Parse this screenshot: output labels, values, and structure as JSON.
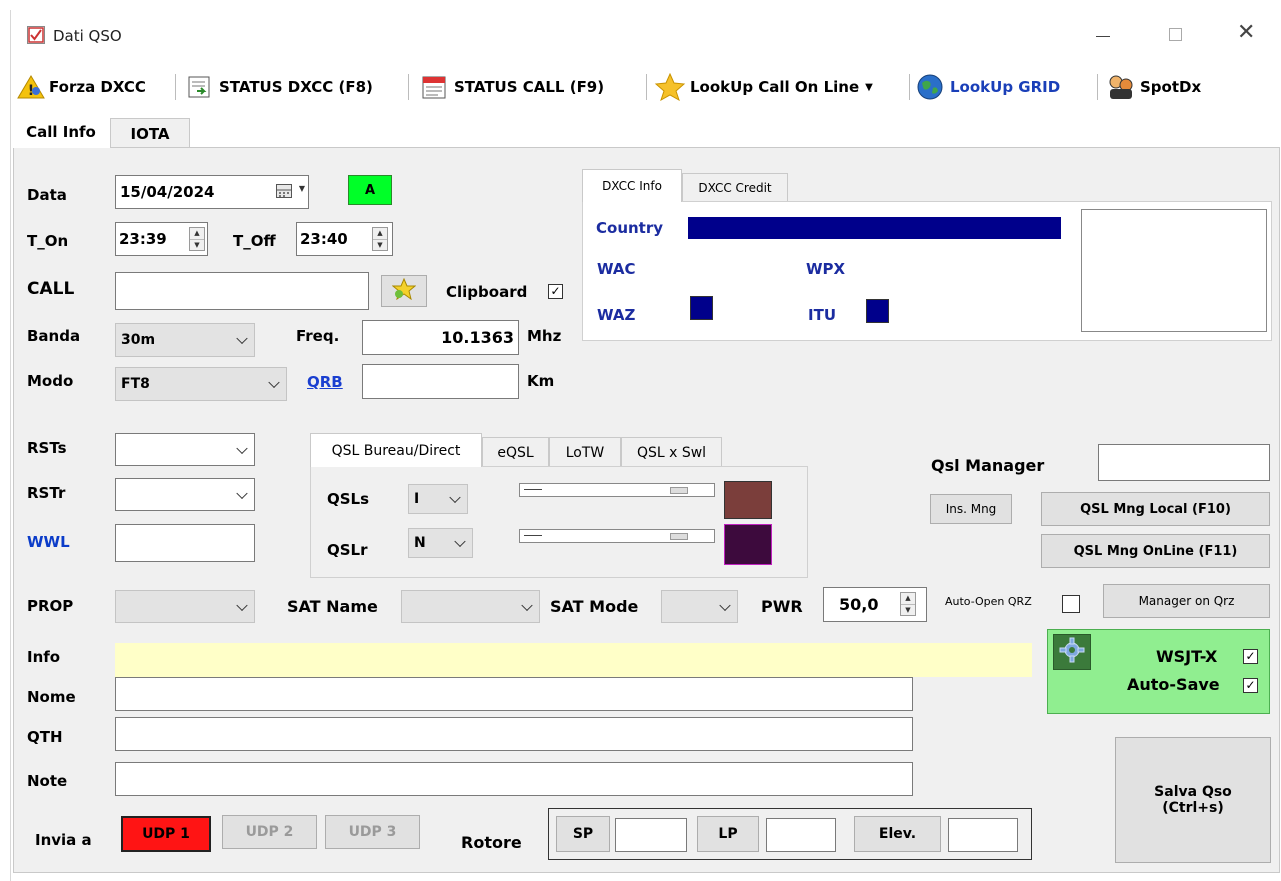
{
  "window": {
    "title": "Dati QSO"
  },
  "toolbar": {
    "forza_dxcc": "Forza DXCC",
    "status_dxcc": "STATUS DXCC (F8)",
    "status_call": "STATUS CALL (F9)",
    "lookup_call": "LookUp Call On Line",
    "lookup_grid": "LookUp GRID",
    "spotdx": "SpotDx"
  },
  "tabs": {
    "call_info": "Call Info",
    "iota": "IOTA"
  },
  "form": {
    "data_label": "Data",
    "data_value": "15/04/2024",
    "a_button": "A",
    "t_on_label": "T_On",
    "t_on_value": "23:39",
    "t_off_label": "T_Off",
    "t_off_value": "23:40",
    "call_label": "CALL",
    "call_value": "",
    "clipboard_label": "Clipboard",
    "clipboard_checked": "✓",
    "banda_label": "Banda",
    "banda_value": "30m",
    "freq_label": "Freq.",
    "freq_value": "10.1363",
    "freq_unit": "Mhz",
    "modo_label": "Modo",
    "modo_value": "FT8",
    "qrb_label": "QRB",
    "qrb_value": "",
    "qrb_unit": "Km",
    "rsts_label": "RSTs",
    "rstr_label": "RSTr",
    "wwl_label": "WWL",
    "prop_label": "PROP",
    "sat_name_label": "SAT Name",
    "sat_mode_label": "SAT Mode",
    "pwr_label": "PWR",
    "pwr_value": "50,0",
    "auto_open_qrz": "Auto-Open QRZ",
    "info_label": "Info",
    "nome_label": "Nome",
    "qth_label": "QTH",
    "note_label": "Note",
    "invia_a_label": "Invia a",
    "udp1": "UDP 1",
    "udp2": "UDP 2",
    "udp3": "UDP 3",
    "rotore_label": "Rotore",
    "sp": "SP",
    "lp": "LP",
    "elev": "Elev."
  },
  "dxcc": {
    "tab_info": "DXCC Info",
    "tab_credit": "DXCC Credit",
    "country": "Country",
    "wac": "WAC",
    "wpx": "WPX",
    "waz": "WAZ",
    "itu": "ITU"
  },
  "qsl": {
    "tab_bureau": "QSL Bureau/Direct",
    "tab_eqsl": "eQSL",
    "tab_lotw": "LoTW",
    "tab_swl": "QSL x Swl",
    "qsls_label": "QSLs",
    "qsls_value": "I",
    "qslr_label": "QSLr",
    "qslr_value": "N",
    "qsls_color": "#7b3e3b",
    "qslr_color": "#3d0a3d"
  },
  "manager": {
    "qsl_manager_label": "Qsl Manager",
    "ins_mng": "Ins. Mng",
    "qsl_mng_local": "QSL Mng Local (F10)",
    "qsl_mng_online": "QSL Mng OnLine (F11)",
    "manager_on_qrz": "Manager on Qrz"
  },
  "wsjt": {
    "wsjtx_label": "WSJT-X",
    "auto_save_label": "Auto-Save",
    "wsjtx_checked": "✓",
    "auto_save_checked": "✓",
    "panel_color": "#90ee90"
  },
  "save_button": {
    "line1": "Salva Qso",
    "line2": "(Ctrl+s)"
  },
  "icons": [
    "app-icon",
    "warning-icon",
    "status-dxcc-icon",
    "status-call-icon",
    "star-icon",
    "globe-icon",
    "spotdx-icon",
    "calendar-icon",
    "gear-icon"
  ]
}
